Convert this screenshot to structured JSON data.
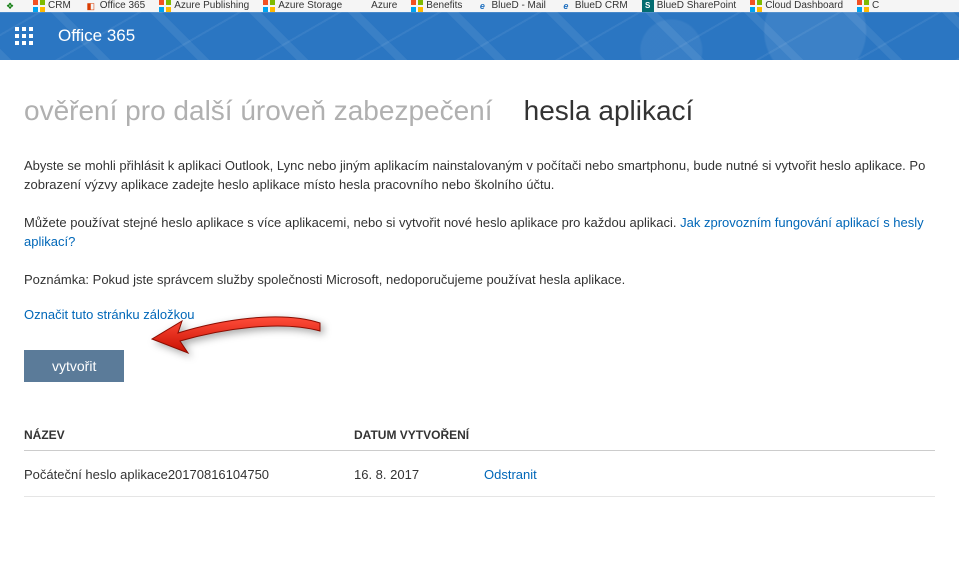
{
  "bookmarks": [
    {
      "icon": "green",
      "label": ""
    },
    {
      "icon": "tiles",
      "label": "CRM"
    },
    {
      "icon": "office",
      "label": "Office 365"
    },
    {
      "icon": "tiles",
      "label": "Azure Publishing"
    },
    {
      "icon": "tiles",
      "label": "Azure Storage"
    },
    {
      "icon": "",
      "label": "Azure"
    },
    {
      "icon": "tiles",
      "label": "Benefits"
    },
    {
      "icon": "ie",
      "label": "BlueD - Mail"
    },
    {
      "icon": "ie",
      "label": "BlueD CRM"
    },
    {
      "icon": "sp",
      "label": "BlueD SharePoint"
    },
    {
      "icon": "tiles",
      "label": "Cloud Dashboard"
    },
    {
      "icon": "tiles",
      "label": "C"
    }
  ],
  "header": {
    "product": "Office 365"
  },
  "heading": {
    "dim": "ověření pro další úroveň zabezpečení",
    "active": "hesla aplikací"
  },
  "paragraphs": {
    "p1": "Abyste se mohli přihlásit k aplikaci Outlook, Lync nebo jiným aplikacím nainstalovaným v počítači nebo smartphonu, bude nutné si vytvořit heslo aplikace. Po zobrazení výzvy aplikace zadejte heslo aplikace místo hesla pracovního nebo školního účtu.",
    "p2a": "Můžete používat stejné heslo aplikace s více aplikacemi, nebo si vytvořit nové heslo aplikace pro každou aplikaci. ",
    "p2link": "Jak zprovozním fungování aplikací s hesly aplikací?",
    "p3": "Poznámka: Pokud jste správcem služby společnosti Microsoft, nedoporučujeme používat hesla aplikace."
  },
  "links": {
    "bookmark_page": "Označit tuto stránku záložkou"
  },
  "buttons": {
    "create": "vytvořit"
  },
  "table": {
    "col_name": "NÁZEV",
    "col_date": "DATUM VYTVOŘENÍ",
    "col_action": "",
    "rows": [
      {
        "name": "Počáteční heslo aplikace20170816104750",
        "date": "16. 8. 2017",
        "action": "Odstranit"
      }
    ]
  }
}
